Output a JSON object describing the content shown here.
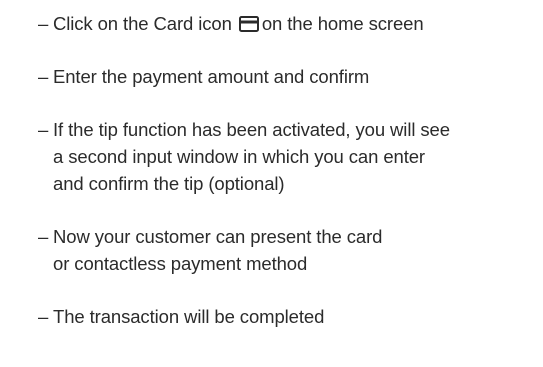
{
  "bullet": "–",
  "steps": [
    {
      "lines": [
        "Click on the Card icon",
        "on the home screen"
      ],
      "icon": "card-icon"
    },
    {
      "lines": [
        "Enter the payment amount and confirm"
      ]
    },
    {
      "lines": [
        "If the tip function has been activated, you will see",
        "a second input window in which you can enter",
        "and confirm the tip (optional)"
      ]
    },
    {
      "lines": [
        "Now your customer can present the card",
        "or contactless payment method"
      ]
    },
    {
      "lines": [
        "The transaction will be completed"
      ]
    }
  ],
  "colors": {
    "text": "#2b2b2b",
    "icon": "#2b2b2b"
  }
}
